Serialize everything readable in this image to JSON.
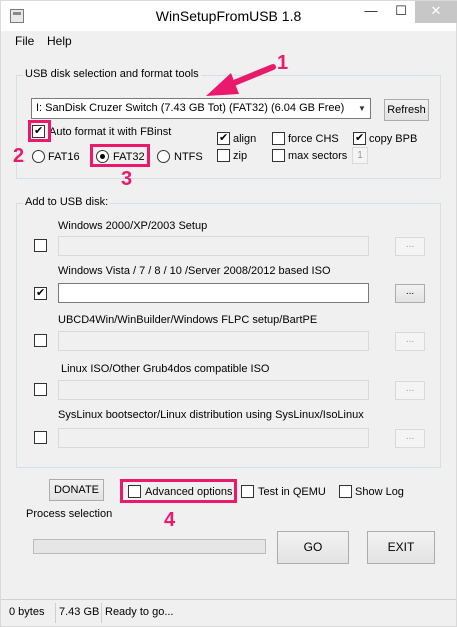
{
  "window": {
    "title": "WinSetupFromUSB 1.8",
    "minimize_glyph": "—",
    "maximize_glyph": "☐",
    "close_glyph": "✕"
  },
  "menu": [
    {
      "label": "File"
    },
    {
      "label": "Help"
    }
  ],
  "usb": {
    "group_label": "USB disk selection and format tools",
    "selected_disk": "I: SanDisk Cruzer Switch (7.43 GB Tot) (FAT32) (6.04 GB Free)",
    "refresh_label": "Refresh",
    "auto_format_label": "Auto format it with FBinst",
    "auto_format_checked": true,
    "fs_options": [
      {
        "label": "FAT16",
        "selected": false
      },
      {
        "label": "FAT32",
        "selected": true
      },
      {
        "label": "NTFS",
        "selected": false
      }
    ],
    "align_label": "align",
    "align_checked": true,
    "zip_label": "zip",
    "zip_checked": false,
    "force_chs_label": "force CHS",
    "force_chs_checked": false,
    "max_sectors_label": "max sectors",
    "max_sectors_checked": false,
    "max_sectors_value": "1",
    "copy_bpb_label": "copy BPB",
    "copy_bpb_checked": true
  },
  "add": {
    "group_label": "Add to USB disk:",
    "browse_label": "...",
    "sources": [
      {
        "label": "Windows 2000/XP/2003 Setup",
        "checked": false,
        "path": ""
      },
      {
        "label": "Windows Vista / 7 / 8 / 10 /Server 2008/2012 based ISO",
        "checked": true,
        "path": ""
      },
      {
        "label": "UBCD4Win/WinBuilder/Windows FLPC setup/BartPE",
        "checked": false,
        "path": ""
      },
      {
        "label": "Linux ISO/Other Grub4dos compatible ISO",
        "checked": false,
        "path": ""
      },
      {
        "label": "SysLinux bootsector/Linux distribution using SysLinux/IsoLinux",
        "checked": false,
        "path": ""
      }
    ]
  },
  "bottom": {
    "donate_label": "DONATE",
    "advanced_label": "Advanced options",
    "advanced_checked": false,
    "qemu_label": "Test in QEMU",
    "qemu_checked": false,
    "showlog_label": "Show Log",
    "showlog_checked": false,
    "process_label": "Process selection",
    "progress": 0,
    "go_label": "GO",
    "exit_label": "EXIT"
  },
  "annotations": {
    "step1": "1",
    "step2": "2",
    "step3": "3",
    "step4": "4",
    "color": "#e9196b"
  },
  "status": {
    "bytes": "0 bytes",
    "size": "7.43 GB",
    "message": "Ready to go..."
  }
}
